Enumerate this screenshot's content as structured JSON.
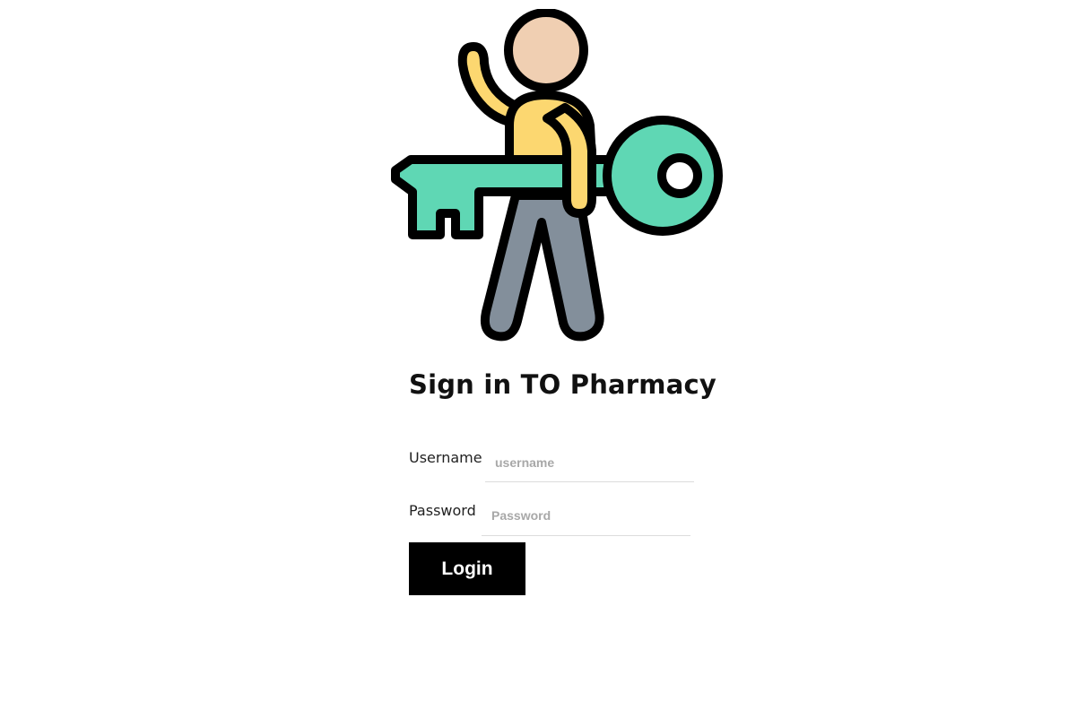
{
  "illustration": {
    "icon": "person-holding-key-icon",
    "colors": {
      "outline": "#000000",
      "skin": "#f0cfb2",
      "shirt": "#fcd770",
      "pants": "#838f9b",
      "key": "#5fd7b4"
    }
  },
  "login_form": {
    "title": "Sign in TO Pharmacy",
    "username_label": "Username",
    "username_placeholder": "username",
    "username_value": "",
    "password_label": "Password",
    "password_placeholder": "Password",
    "password_value": "",
    "login_label": "Login"
  }
}
